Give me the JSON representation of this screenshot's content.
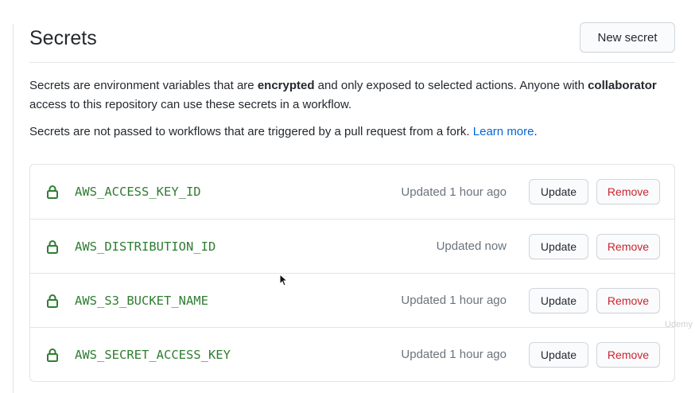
{
  "header": {
    "title": "Secrets",
    "new_secret_label": "New secret"
  },
  "description": {
    "p1_a": "Secrets are environment variables that are ",
    "p1_b": "encrypted",
    "p1_c": " and only exposed to selected actions. Anyone with ",
    "p1_d": "collaborator",
    "p1_e": " access to this repository can use these secrets in a workflow.",
    "p2_a": "Secrets are not passed to workflows that are triggered by a pull request from a fork. ",
    "p2_link": "Learn more",
    "p2_end": "."
  },
  "secrets": [
    {
      "name": "AWS_ACCESS_KEY_ID",
      "updated": "Updated 1 hour ago",
      "update_label": "Update",
      "remove_label": "Remove"
    },
    {
      "name": "AWS_DISTRIBUTION_ID",
      "updated": "Updated now",
      "update_label": "Update",
      "remove_label": "Remove"
    },
    {
      "name": "AWS_S3_BUCKET_NAME",
      "updated": "Updated 1 hour ago",
      "update_label": "Update",
      "remove_label": "Remove"
    },
    {
      "name": "AWS_SECRET_ACCESS_KEY",
      "updated": "Updated 1 hour ago",
      "update_label": "Update",
      "remove_label": "Remove"
    }
  ],
  "icons": {
    "secret": "lock-icon"
  },
  "colors": {
    "secret_name": "#2f7d32",
    "remove": "#cb2431",
    "link": "#0366d6"
  },
  "watermark": "Udemy"
}
